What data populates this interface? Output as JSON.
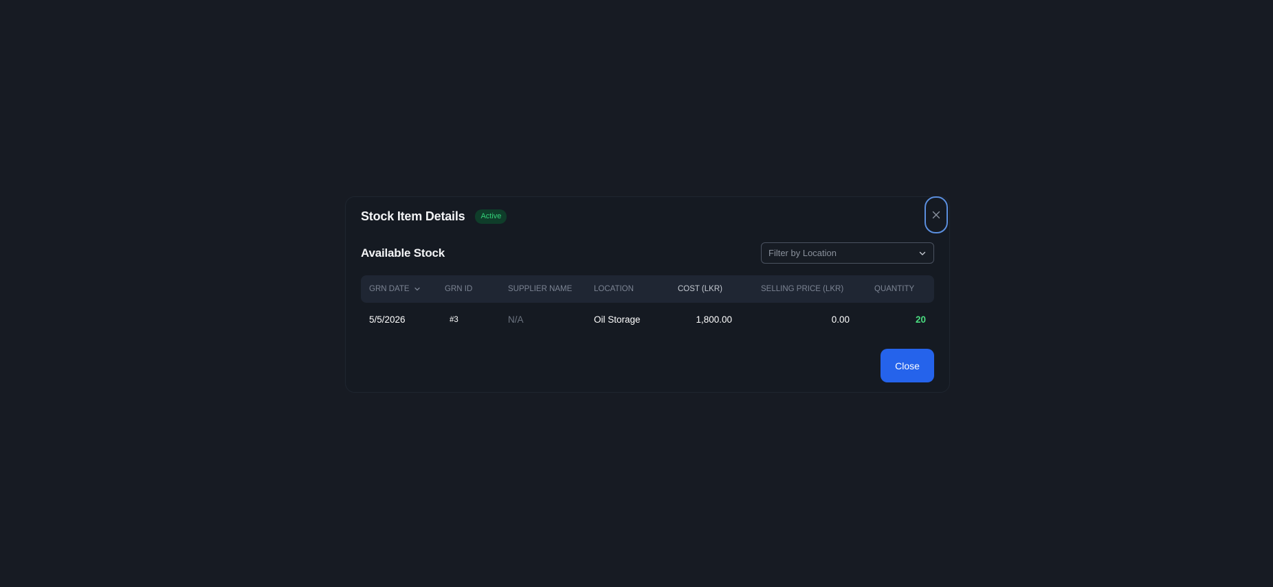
{
  "modal": {
    "title": "Stock Item Details",
    "status": "Active",
    "close_icon": "close-icon",
    "section_title": "Available Stock",
    "filter": {
      "placeholder": "Filter by Location",
      "icon": "chevron-down-icon"
    },
    "table": {
      "columns": [
        "GRN DATE",
        "GRN ID",
        "SUPPLIER NAME",
        "LOCATION",
        "COST (LKR)",
        "SELLING PRICE (LKR)",
        "QUANTITY"
      ],
      "sort_icon": "chevron-down-icon",
      "rows": [
        {
          "grn_date": "5/5/2026",
          "grn_id": "#3",
          "supplier_name": "N/A",
          "location": "Oil Storage",
          "cost": "1,800.00",
          "selling_price": "0.00",
          "quantity": "20"
        }
      ]
    },
    "close_button_label": "Close"
  },
  "colors": {
    "background": "#171b23",
    "accent": "#2563eb",
    "badge_text": "#34d27a",
    "quantity": "#4ade80"
  }
}
